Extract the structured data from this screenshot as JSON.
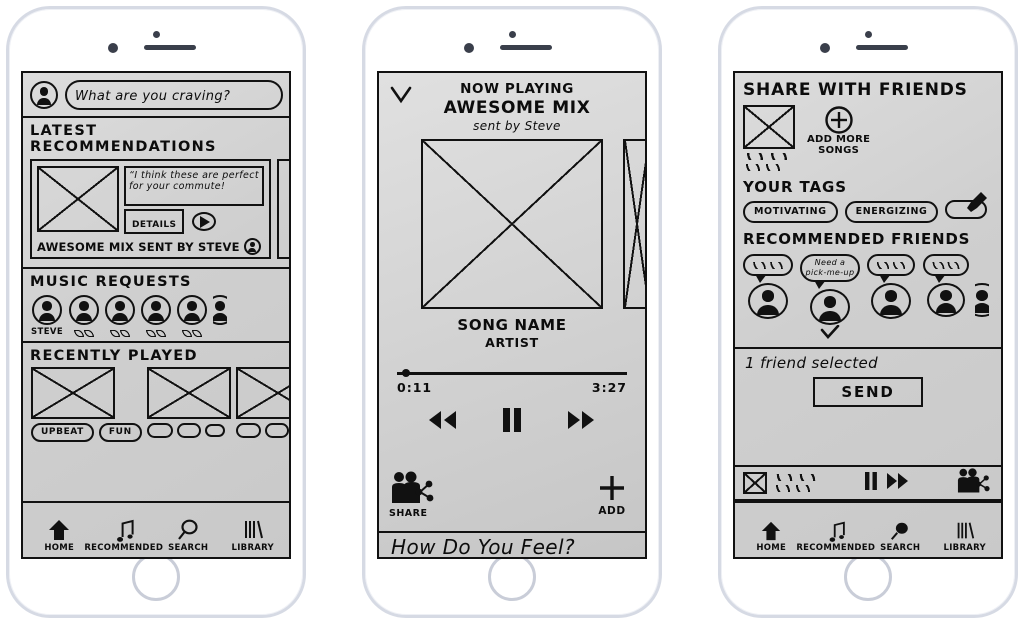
{
  "meta": {
    "ink_color": "#0c0c0c",
    "frame_color": "#d6dae4",
    "screen_color": "#d2d2d2",
    "page_background": "#ffffff"
  },
  "nav": {
    "items": [
      {
        "label": "HOME",
        "icon": "up-arrow-icon"
      },
      {
        "label": "RECOMMENDED",
        "icon": "music-note-icon"
      },
      {
        "label": "SEARCH",
        "icon": "magnifier-icon"
      },
      {
        "label": "LIBRARY",
        "icon": "books-icon"
      }
    ]
  },
  "phone1": {
    "search": {
      "placeholder": "What are you craving?",
      "avatar_icon": "user-avatar-icon"
    },
    "recommendations": {
      "title": "LATEST RECOMMENDATIONS",
      "card": {
        "art_icon": "image-placeholder-icon",
        "quote": "“I think these are perfect for your commute!",
        "details_label": "DETAILS",
        "play_icon": "play-icon",
        "footer": "AWESOME MIX sent by Steve",
        "footer_avatar_icon": "user-avatar-icon"
      }
    },
    "music_requests": {
      "title": "MUSIC REQUESTS",
      "first_label": "STEVE",
      "avatars": 6
    },
    "recently_played": {
      "title": "RECENTLY PLAYED",
      "items": [
        {
          "art_icon": "image-placeholder-icon",
          "tags": [
            "UPBEAT",
            "FUN"
          ]
        },
        {
          "art_icon": "image-placeholder-icon",
          "tags": [
            "",
            ""
          ]
        },
        {
          "art_icon": "image-placeholder-icon",
          "tags": [
            "",
            ""
          ]
        }
      ]
    }
  },
  "phone2": {
    "header": {
      "collapse_icon": "chevron-down-icon",
      "eyebrow": "NOW PLAYING",
      "title": "AWESOME MIX",
      "subtitle": "sent by Steve"
    },
    "album_art_icon": "image-placeholder-icon",
    "track": {
      "name": "SONG NAME",
      "artist": "ARTIST"
    },
    "progress": {
      "elapsed": "0:11",
      "total": "3:27",
      "percent": 5
    },
    "controls": {
      "rewind_icon": "rewind-icon",
      "pause_icon": "pause-icon",
      "forward_icon": "fast-forward-icon"
    },
    "share": {
      "label": "SHARE",
      "icon": "share-people-icon"
    },
    "add": {
      "label": "ADD",
      "icon": "plus-icon"
    },
    "sheet_peek": "How Do You Feel?"
  },
  "phone3": {
    "title": "SHARE WITH FRIENDS",
    "playlist": {
      "art_icon": "image-placeholder-icon",
      "add_more": {
        "icon": "plus-circle-icon",
        "line1": "ADD MORE",
        "line2": "SONGS"
      }
    },
    "tags": {
      "title": "YOUR TAGS",
      "items": [
        "MOTIVATING",
        "ENERGIZING"
      ],
      "add_tag_icon": "hand-pointer-icon"
    },
    "friends": {
      "title": "RECOMMENDED FRIENDS",
      "list": [
        {
          "bubble": "",
          "selected": false
        },
        {
          "bubble": "Need a pick-me-up",
          "selected": true
        },
        {
          "bubble": "",
          "selected": false
        },
        {
          "bubble": "",
          "selected": false
        },
        {
          "bubble": "",
          "selected": false
        }
      ]
    },
    "selection": {
      "status": "1 friend selected",
      "send_label": "SEND"
    },
    "mini_player": {
      "art_icon": "image-placeholder-icon",
      "pause_icon": "pause-icon",
      "forward_icon": "fast-forward-icon",
      "share_icon": "share-people-icon"
    }
  }
}
